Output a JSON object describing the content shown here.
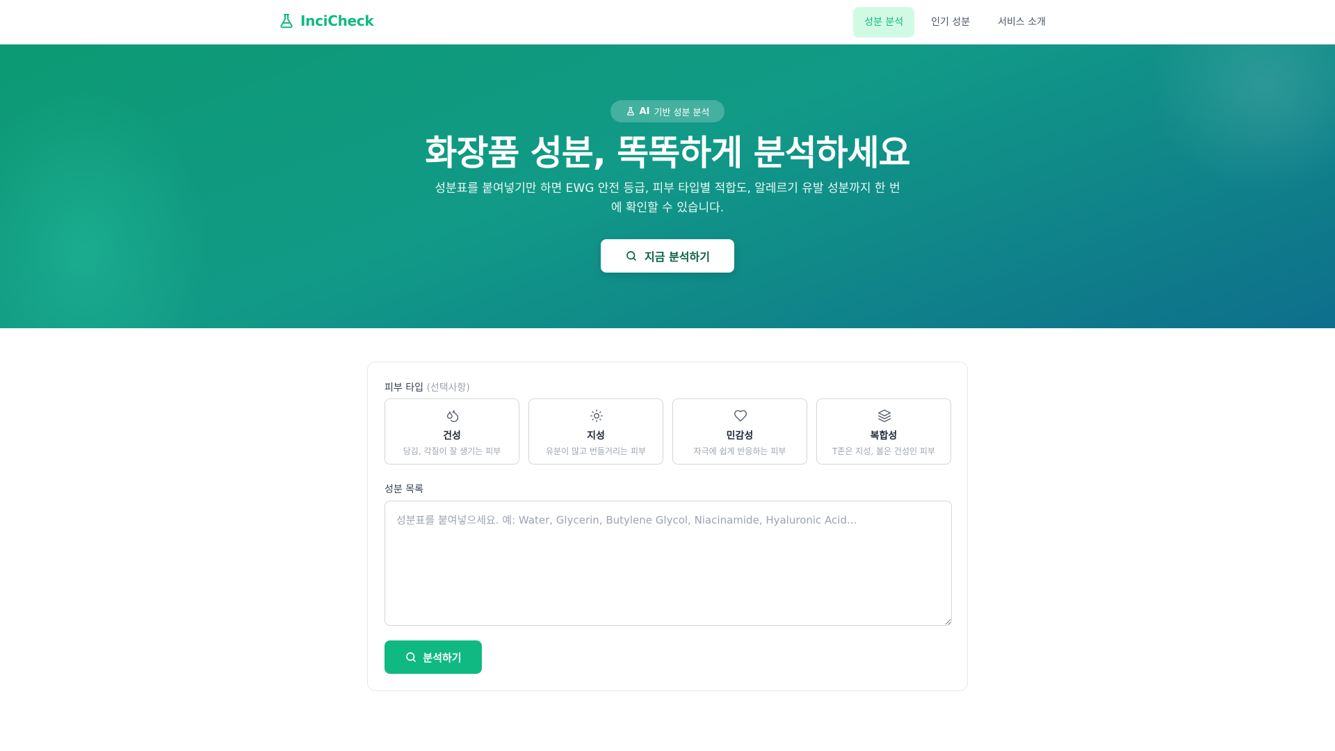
{
  "brand": {
    "name": "InciCheck",
    "icon": "flask-icon"
  },
  "nav": {
    "items": [
      {
        "label": "성분 분석",
        "active": true
      },
      {
        "label": "인기 성분",
        "active": false
      },
      {
        "label": "서비스 소개",
        "active": false
      }
    ]
  },
  "hero": {
    "badge": {
      "icon": "flask-icon",
      "strong": "AI",
      "text": "기반 성분 분석"
    },
    "title": "화장품 성분, 똑똑하게 분석하세요",
    "description": "성분표를 붙여넣기만 하면 EWG 안전 등급, 피부 타입별 적합도, 알레르기 유발 성분까지 한 번에 확인할 수 있습니다.",
    "cta": {
      "icon": "search-icon",
      "label": "지금 분석하기"
    }
  },
  "form": {
    "skin_type_label": "피부 타입",
    "skin_type_optional": "(선택사항)",
    "skin_types": [
      {
        "icon": "droplets-icon",
        "name": "건성",
        "desc": "당김, 각질이 잘 생기는 피부"
      },
      {
        "icon": "sun-icon",
        "name": "지성",
        "desc": "유분이 많고 번들거리는 피부"
      },
      {
        "icon": "heart-icon",
        "name": "민감성",
        "desc": "자극에 쉽게 반응하는 피부"
      },
      {
        "icon": "layers-icon",
        "name": "복합성",
        "desc": "T존은 지성, 볼은 건성인 피부"
      }
    ],
    "ingredients_label": "성분 목록",
    "ingredients_value": "",
    "ingredients_placeholder": "성분표를 붙여넣으세요. 예: Water, Glycerin, Butylene Glycol, Niacinamide, Hyaluronic Acid...",
    "submit": {
      "icon": "search-icon",
      "label": "분석하기"
    }
  },
  "colors": {
    "brand": "#10b981",
    "nav_active_bg": "#d1fae5",
    "hero_gradient_start": "#0c9a73",
    "hero_gradient_end": "#0e6f8c"
  }
}
